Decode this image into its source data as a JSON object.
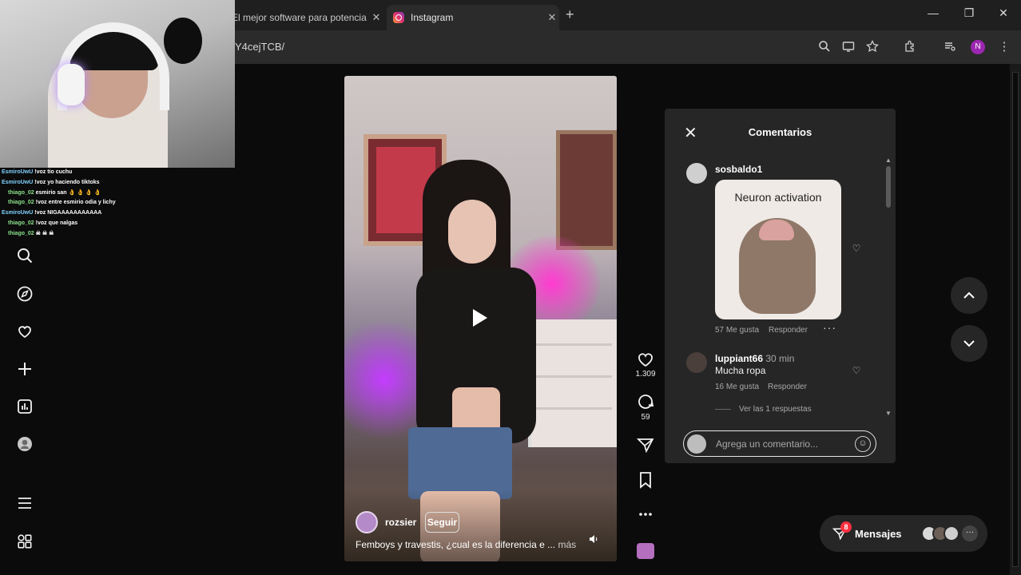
{
  "browser": {
    "tabs": [
      {
        "title": "El mejor software para potencia",
        "close": "✕"
      },
      {
        "title": "Instagram",
        "close": "✕"
      }
    ],
    "new_tab": "+",
    "url": "Y4cejTCB/",
    "profile_initial": "N",
    "window": {
      "minimize": "—",
      "maximize": "❐",
      "close": "✕"
    }
  },
  "stream_chat": [
    {
      "user": "EsmiroUwU",
      "text": "!voz tio cuchu"
    },
    {
      "user": "EsmiroUwU",
      "text": "!voz yo haciendo tiktoks"
    },
    {
      "user": "thiago_02",
      "text": "esmirio san 👌 👌 👌 👌"
    },
    {
      "user": "thiago_02",
      "text": "!voz entre esmirio odia y lichy"
    },
    {
      "user": "EsmiroUwU",
      "text": "!voz NIGAAAAAAAAAAA"
    },
    {
      "user": "thiago_02",
      "text": "!voz que nalgas"
    },
    {
      "user": "thiago_02",
      "text": "☠ ☠ ☠"
    }
  ],
  "post": {
    "author": "rozsier",
    "follow_label": "Seguir",
    "caption": "Femboys y travestis, ¿cual es la diferencia e ...",
    "caption_more": "más",
    "likes": "1.309",
    "comments_count": "59"
  },
  "comments_panel": {
    "title": "Comentarios",
    "comments": [
      {
        "user": "sosbaldo1",
        "time": "",
        "text": "",
        "image_caption": "Neuron activation",
        "likes": "57 Me gusta",
        "reply": "Responder"
      },
      {
        "user": "luppiant66",
        "time": "30 min",
        "text": "Mucha ropa",
        "likes": "16 Me gusta",
        "reply": "Responder"
      }
    ],
    "view_replies": "Ver las 1 respuestas",
    "input_placeholder": "Agrega un comentario..."
  },
  "messages": {
    "label": "Mensajes",
    "badge": "8"
  },
  "colors": {
    "accent_badge": "#ff3040",
    "panel_bg": "#262626",
    "page_bg": "#0b0b0b"
  }
}
